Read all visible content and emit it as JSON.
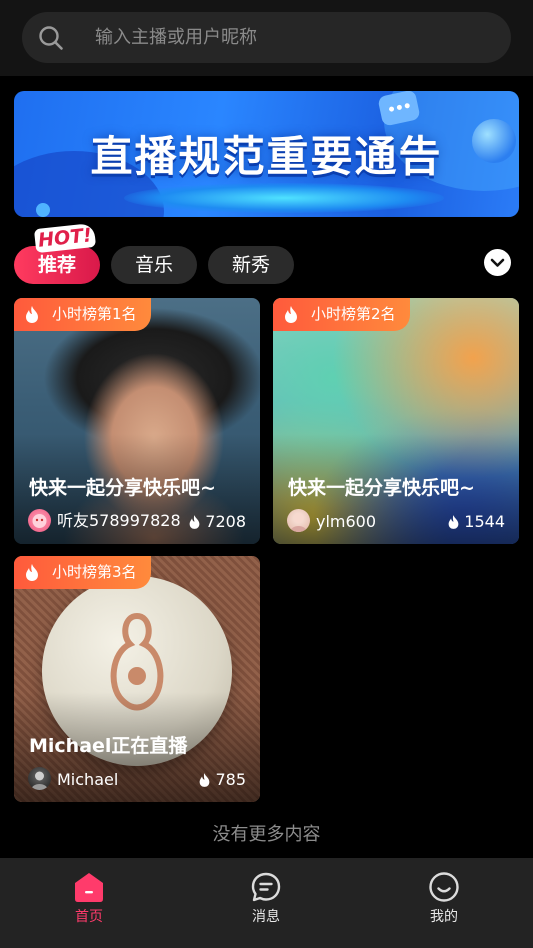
{
  "search": {
    "placeholder": "输入主播或用户昵称"
  },
  "banner": {
    "title": "直播规范重要通告"
  },
  "tabs": {
    "hot_badge": "HOT!",
    "items": [
      {
        "label": "推荐",
        "active": true
      },
      {
        "label": "音乐",
        "active": false
      },
      {
        "label": "新秀",
        "active": false
      }
    ]
  },
  "cards": [
    {
      "rank": "小时榜第1名",
      "title": "快来一起分享快乐吧~",
      "name": "听友578997828",
      "heat": "7208"
    },
    {
      "rank": "小时榜第2名",
      "title": "快来一起分享快乐吧~",
      "name": "ylm600",
      "heat": "1544"
    },
    {
      "rank": "小时榜第3名",
      "title": "Michael正在直播",
      "name": "Michael",
      "heat": "785"
    }
  ],
  "list_footer": "没有更多内容",
  "bottom_nav": [
    {
      "label": "首页",
      "icon": "home-icon",
      "active": true
    },
    {
      "label": "消息",
      "icon": "message-icon",
      "active": false
    },
    {
      "label": "我的",
      "icon": "profile-icon",
      "active": false
    }
  ],
  "colors": {
    "accent": "#ff3b6b",
    "rank_badge": "#ff6a3c",
    "background": "#000000"
  }
}
